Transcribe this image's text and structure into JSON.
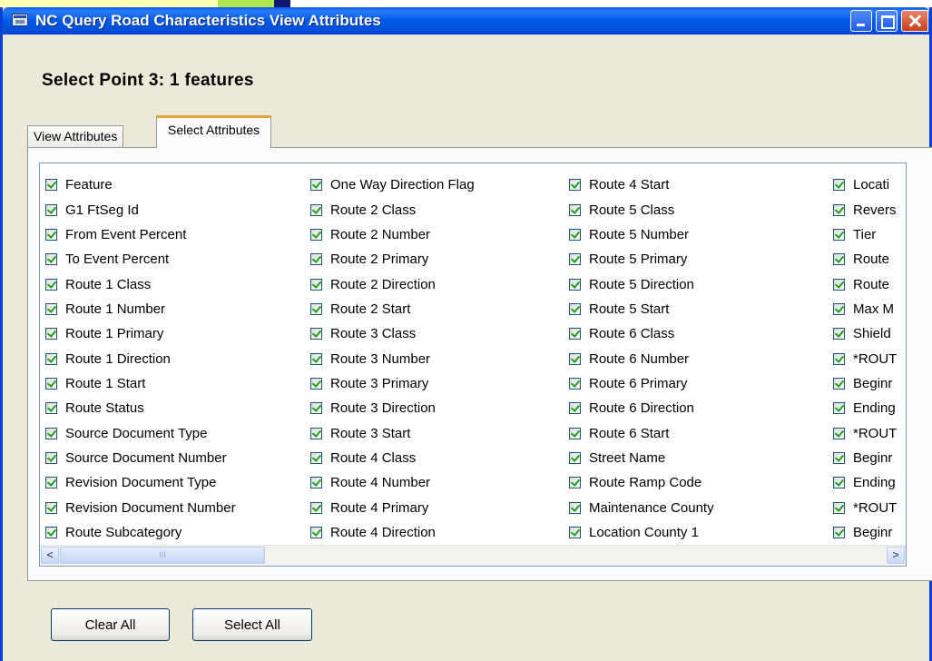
{
  "window": {
    "title": "NC Query Road Characteristics View Attributes",
    "heading": "Select Point 3: 1 features"
  },
  "tabs": [
    {
      "label": "View Attributes",
      "active": false
    },
    {
      "label": "Select Attributes",
      "active": true
    }
  ],
  "attributes": {
    "col1": [
      "Feature",
      "G1 FtSeg Id",
      "From Event Percent",
      "To Event Percent",
      "Route 1 Class",
      "Route 1 Number",
      "Route 1 Primary",
      "Route 1 Direction",
      "Route 1 Start",
      "Route Status",
      "Source Document Type",
      "Source Document Number",
      "Revision Document Type",
      "Revision Document Number",
      "Route Subcategory"
    ],
    "col2": [
      "One Way Direction Flag",
      "Route 2 Class",
      "Route 2 Number",
      "Route 2 Primary",
      "Route 2 Direction",
      "Route 2 Start",
      "Route 3 Class",
      "Route 3 Number",
      "Route 3 Primary",
      "Route 3 Direction",
      "Route 3 Start",
      "Route 4 Class",
      "Route 4 Number",
      "Route 4 Primary",
      "Route 4 Direction"
    ],
    "col3": [
      "Route 4 Start",
      "Route 5 Class",
      "Route 5 Number",
      "Route 5 Primary",
      "Route 5 Direction",
      "Route 5 Start",
      "Route 6 Class",
      "Route 6 Number",
      "Route 6 Primary",
      "Route 6 Direction",
      "Route 6 Start",
      "Street Name",
      "Route Ramp Code",
      "Maintenance County",
      "Location County 1"
    ],
    "col4": [
      "Locati",
      "Revers",
      "Tier",
      "Route",
      "Route",
      "Max M",
      "Shield",
      "*ROUT",
      "Beginr",
      "Ending",
      "*ROUT",
      "Beginr",
      "Ending",
      "*ROUT",
      "Beginr"
    ]
  },
  "buttons": {
    "clear_all": "Clear All",
    "select_all": "Select All"
  },
  "scrollbar": {
    "left_arrow": "<",
    "right_arrow": ">",
    "grip": "III"
  },
  "colors": {
    "titlebar": "#0058e6",
    "dialog_bg": "#ece9d8",
    "check": "#21a121",
    "tab_highlight": "#e8a53c"
  }
}
